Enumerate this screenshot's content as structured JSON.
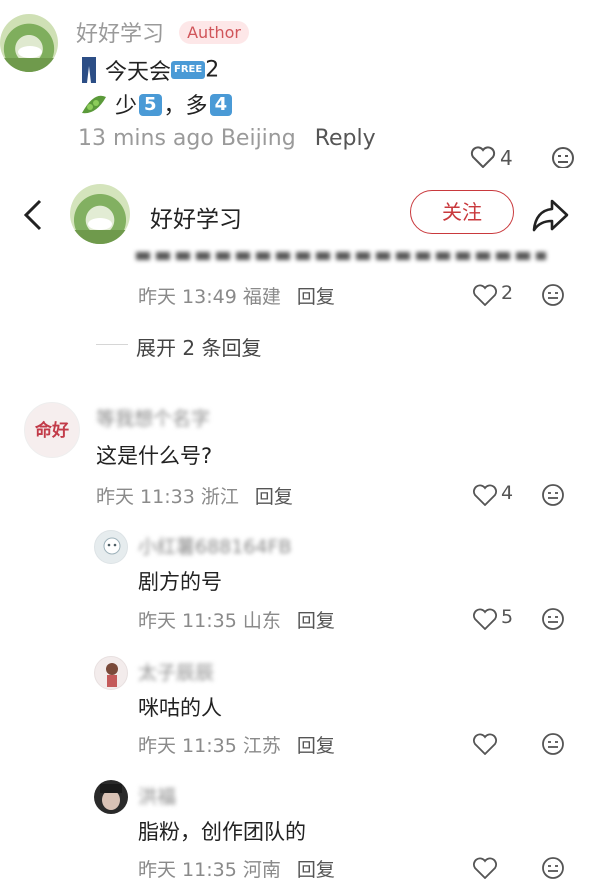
{
  "top_comment": {
    "username": "好好学习",
    "badge": "Author",
    "line1_text": "今天会",
    "line1_free": "FREE",
    "line1_suffix": "2",
    "line2_prefix": "少",
    "line2_num1": "5",
    "line2_sep": "，多",
    "line2_num2": "4",
    "time": "13 mins ago Beijing",
    "reply": "Reply",
    "likes": "4"
  },
  "header": {
    "title": "好好学习",
    "follow_label": "关注"
  },
  "cut_comment": {
    "meta": "昨天 13:49 福建",
    "reply": "回复",
    "likes": "2"
  },
  "expand": {
    "label": "展开 2 条回复"
  },
  "comments": [
    {
      "username": "等我想个名字",
      "avatar_text": "命好",
      "text": "这是什么号?",
      "meta": "昨天 11:33 浙江",
      "reply": "回复",
      "likes": "4"
    }
  ],
  "replies": [
    {
      "username": "小红薯688164FB",
      "text": "剧方的号",
      "meta": "昨天 11:35 山东",
      "reply": "回复",
      "likes": "5"
    },
    {
      "username": "太子辰辰",
      "text": "咪咕的人",
      "meta": "昨天 11:35 江苏",
      "reply": "回复",
      "likes": ""
    },
    {
      "username": "洪福",
      "text": "脂粉，创作团队的",
      "meta": "昨天 11:35 河南",
      "reply": "回复",
      "likes": ""
    }
  ],
  "colors": {
    "accent": "#c9393d",
    "keycap": "#4a9ad6",
    "muted": "#8a8a8a"
  }
}
